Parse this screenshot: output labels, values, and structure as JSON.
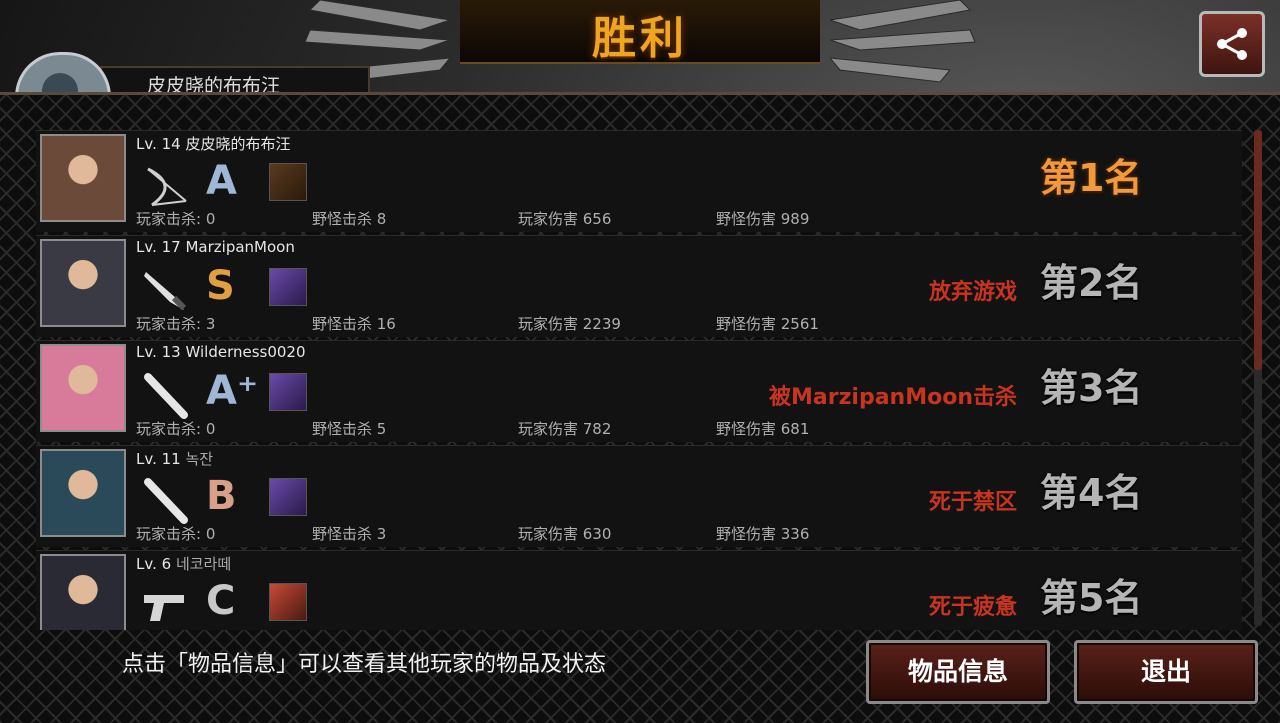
{
  "header": {
    "title": "胜利",
    "player_name": "皮皮晓的布布汪"
  },
  "colors": {
    "title_gold": "#f0a520",
    "first_rank": "#f09a3c",
    "status_red": "#c8341f",
    "button_red": "#5a2119"
  },
  "players": [
    {
      "level": "Lv. 14",
      "name": "皮皮晓的布布汪",
      "weapon": "bow-icon",
      "grade": "A",
      "grade_color": "#9fb6d6",
      "item": "crossed-item-icon",
      "player_kills": "玩家击杀: 0",
      "monster_kills": "野怪击杀 8",
      "player_damage": "玩家伤害 656",
      "monster_damage": "野怪伤害 989",
      "status": "",
      "rank": "第1名"
    },
    {
      "level": "Lv. 17",
      "name": "MarzipanMoon",
      "weapon": "knife-icon",
      "grade": "S",
      "grade_color": "#e0a040",
      "item": "purple-creature-icon",
      "player_kills": "玩家击杀: 3",
      "monster_kills": "野怪击杀 16",
      "player_damage": "玩家伤害 2239",
      "monster_damage": "野怪伤害 2561",
      "status": "放弃游戏",
      "rank": "第2名"
    },
    {
      "level": "Lv. 13",
      "name": "Wilderness0020",
      "weapon": "bat-icon",
      "grade": "A⁺",
      "grade_color": "#9fb6d6",
      "item": "purple-creature-icon",
      "player_kills": "玩家击杀: 0",
      "monster_kills": "野怪击杀 5",
      "player_damage": "玩家伤害 782",
      "monster_damage": "野怪伤害 681",
      "status": "被MarzipanMoon击杀",
      "rank": "第3名"
    },
    {
      "level": "Lv. 11",
      "name": "녹잔",
      "weapon": "bat-icon",
      "grade": "B",
      "grade_color": "#d8a088",
      "item": "purple-creature-icon",
      "player_kills": "玩家击杀: 0",
      "monster_kills": "野怪击杀 3",
      "player_damage": "玩家伤害 630",
      "monster_damage": "野怪伤害 336",
      "status": "死于禁区",
      "rank": "第4名"
    },
    {
      "level": "Lv. 6",
      "name": "네코라떼",
      "weapon": "pistol-icon",
      "grade": "C",
      "grade_color": "#c8c8c8",
      "item": "red-face-icon",
      "player_kills": "",
      "monster_kills": "",
      "player_damage": "",
      "monster_damage": "",
      "status": "死于疲惫",
      "rank": "第5名"
    }
  ],
  "footer": {
    "hint": "点击「物品信息」可以查看其他玩家的物品及状态",
    "items_button": "物品信息",
    "exit_button": "退出"
  }
}
